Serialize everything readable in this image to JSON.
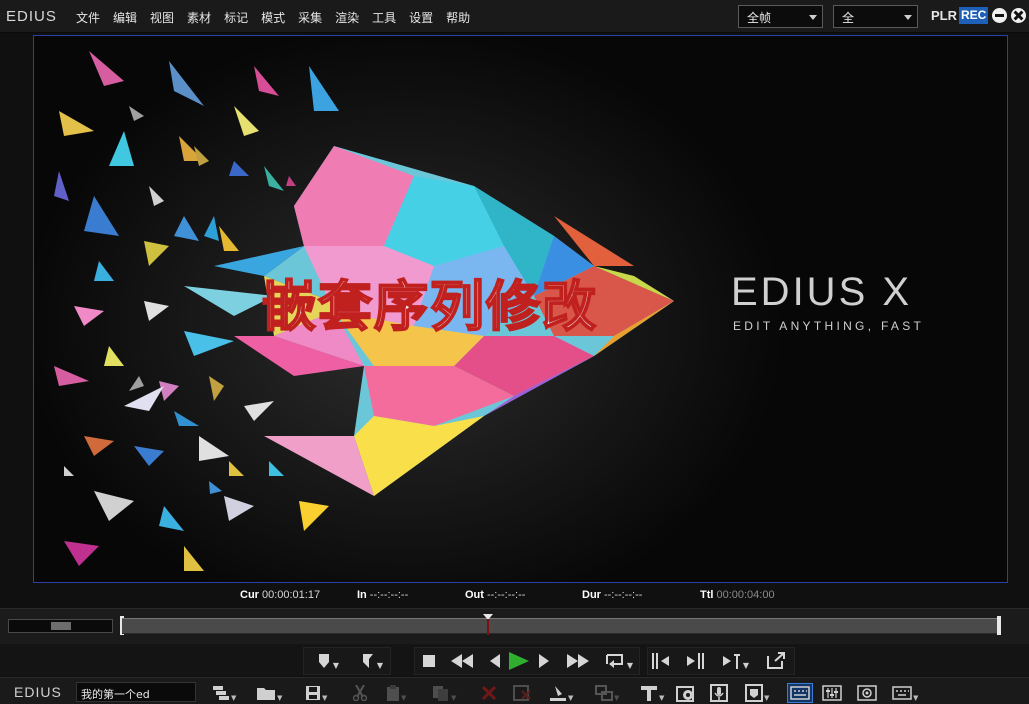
{
  "app": {
    "logo": "EDIUS"
  },
  "menu": {
    "items": [
      "文件",
      "编辑",
      "视图",
      "素材",
      "标记",
      "模式",
      "采集",
      "渲染",
      "工具",
      "设置",
      "帮助"
    ]
  },
  "header": {
    "frame_mode": "全帧",
    "view_mode": "全",
    "plr_label": "PLR",
    "rec_label": "REC"
  },
  "preview": {
    "overlay_title": "嵌套序列修改",
    "brand": "EDIUS X",
    "tagline": "EDIT ANYTHING, FAST"
  },
  "timecodes": [
    {
      "key": "Cur",
      "value": "00:00:01:17",
      "dim": false
    },
    {
      "key": "In",
      "value": "--:--:--:--",
      "dim": false
    },
    {
      "key": "Out",
      "value": "--:--:--:--",
      "dim": false
    },
    {
      "key": "Dur",
      "value": "--:--:--:--",
      "dim": false
    },
    {
      "key": "Ttl",
      "value": "00:00:04:00",
      "dim": true
    }
  ],
  "timeline": {
    "playhead_fraction": 0.417
  },
  "bottom": {
    "logo": "EDIUS",
    "project_name": "我的第一个ed"
  },
  "colors": {
    "accent": "#1e5fb8",
    "frame_border": "#2b3fa8",
    "play_green": "#2fae2f",
    "title_stroke": "#c0201e"
  },
  "icons": {
    "transport": [
      "set-in-icon",
      "set-out-icon",
      "stop-icon",
      "rewind-icon",
      "step-back-icon",
      "play-icon",
      "step-forward-icon",
      "fast-forward-icon",
      "loop-icon",
      "insert-to-timeline-icon",
      "overwrite-to-timeline-icon",
      "export-icon",
      "sync-icon"
    ],
    "toolbar": [
      "new-sequence-icon",
      "open-project-icon",
      "save-project-icon",
      "cut-icon",
      "copy-icon",
      "paste-icon",
      "delete-icon",
      "ripple-delete-icon",
      "layout-icon",
      "transform-icon",
      "title-icon",
      "render-icon",
      "voice-over-icon",
      "marker-icon",
      "keyboard-icon",
      "mixer-icon",
      "color-correction-icon",
      "keyboard-shortcut-icon"
    ]
  }
}
